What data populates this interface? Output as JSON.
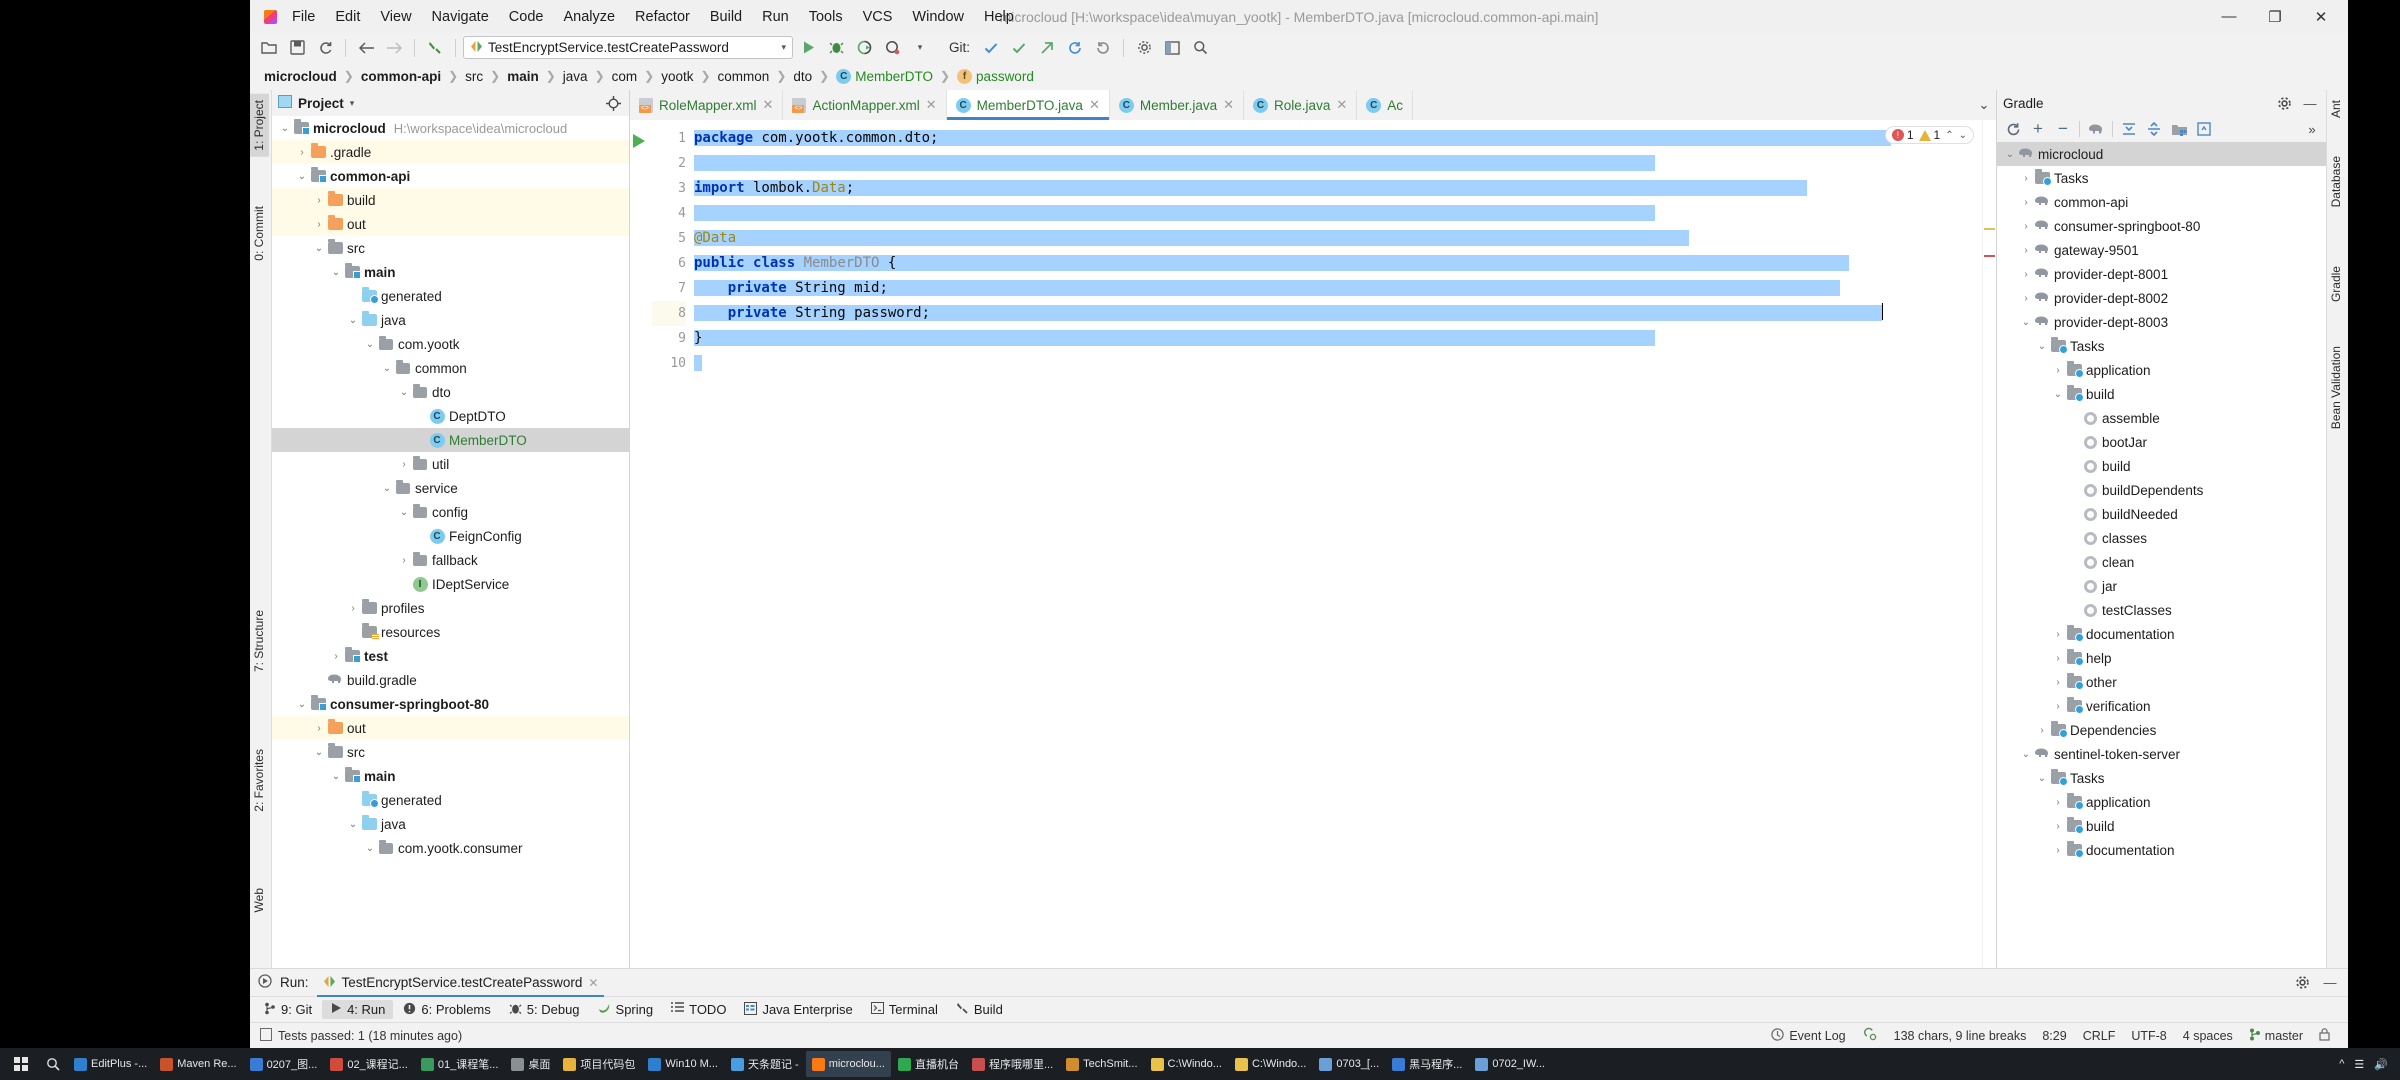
{
  "window": {
    "title": "microcloud [H:\\workspace\\idea\\muyan_yootk] - MemberDTO.java [microcloud.common-api.main]",
    "minimize": "—",
    "maximize": "❐",
    "close": "✕"
  },
  "menubar": [
    "File",
    "Edit",
    "View",
    "Navigate",
    "Code",
    "Analyze",
    "Refactor",
    "Build",
    "Run",
    "Tools",
    "VCS",
    "Window",
    "Help"
  ],
  "toolbar": {
    "open_icon": "folder-open-icon",
    "save_icon": "save-icon",
    "sync_icon": "sync-icon",
    "back_icon": "←",
    "forward_icon": "→",
    "build_icon": "hammer-icon",
    "run_config": "TestEncryptService.testCreatePassword",
    "run_config_caret": "▾",
    "run_icon": "▶",
    "debug_icon": "debug-icon",
    "coverage_icon": "coverage-icon",
    "profile_icon": "profile-icon",
    "profile_caret": "▾",
    "git_label": "Git:",
    "git_update": "✓",
    "git_commit": "✔",
    "git_push": "↗",
    "git_history": "↺",
    "git_rollback": "↶",
    "settings_icon": "gear-icon",
    "layout_icon": "layout-icon",
    "search_icon": "search-icon"
  },
  "breadcrumb": [
    {
      "label": "microcloud",
      "bold": true
    },
    {
      "label": "common-api",
      "bold": true
    },
    {
      "label": "src",
      "bold": false
    },
    {
      "label": "main",
      "bold": true
    },
    {
      "label": "java",
      "bold": false
    },
    {
      "label": "com",
      "bold": false
    },
    {
      "label": "yootk",
      "bold": false
    },
    {
      "label": "common",
      "bold": false
    },
    {
      "label": "dto",
      "bold": false
    },
    {
      "label": "MemberDTO",
      "bold": false,
      "icon": "class-icon",
      "green": true
    },
    {
      "label": "password",
      "bold": false,
      "icon": "field-icon",
      "green": true
    }
  ],
  "left_rail": [
    {
      "label": "1: Project",
      "selected": true
    },
    {
      "label": "0: Commit",
      "selected": false
    },
    {
      "label": "7: Structure",
      "selected": false
    },
    {
      "label": "2: Favorites",
      "selected": false
    },
    {
      "label": "Web",
      "selected": false
    }
  ],
  "right_rail": [
    {
      "label": "Ant"
    },
    {
      "label": "Database"
    },
    {
      "label": "Gradle"
    },
    {
      "label": "Bean Validation"
    }
  ],
  "project_panel": {
    "title": "Project",
    "caret": "▾",
    "locate_icon": "locate-icon",
    "minimize_icon": "—",
    "tree": [
      {
        "indent": 0,
        "tw": "⌄",
        "icon": "module",
        "label": "microcloud",
        "bold": true,
        "sub": "H:\\workspace\\idea\\microcloud"
      },
      {
        "indent": 1,
        "tw": "›",
        "icon": "folder-orange",
        "label": ".gradle",
        "hl": "yellow"
      },
      {
        "indent": 1,
        "tw": "⌄",
        "icon": "module",
        "label": "common-api",
        "bold": true
      },
      {
        "indent": 2,
        "tw": "›",
        "icon": "folder-orange",
        "label": "build",
        "hl": "yellow"
      },
      {
        "indent": 2,
        "tw": "›",
        "icon": "folder-orange",
        "label": "out",
        "hl": "yellow"
      },
      {
        "indent": 2,
        "tw": "⌄",
        "icon": "folder-gray",
        "label": "src"
      },
      {
        "indent": 3,
        "tw": "⌄",
        "icon": "module",
        "label": "main",
        "bold": true
      },
      {
        "indent": 4,
        "tw": "",
        "icon": "folder-generated",
        "label": "generated"
      },
      {
        "indent": 4,
        "tw": "⌄",
        "icon": "folder-blue",
        "label": "java"
      },
      {
        "indent": 5,
        "tw": "⌄",
        "icon": "package",
        "label": "com.yootk"
      },
      {
        "indent": 6,
        "tw": "⌄",
        "icon": "package",
        "label": "common"
      },
      {
        "indent": 7,
        "tw": "⌄",
        "icon": "package",
        "label": "dto"
      },
      {
        "indent": 8,
        "tw": "",
        "icon": "class",
        "label": "DeptDTO"
      },
      {
        "indent": 8,
        "tw": "",
        "icon": "class",
        "label": "MemberDTO",
        "green": true,
        "hl": "sel"
      },
      {
        "indent": 7,
        "tw": "›",
        "icon": "package",
        "label": "util"
      },
      {
        "indent": 6,
        "tw": "⌄",
        "icon": "package",
        "label": "service"
      },
      {
        "indent": 7,
        "tw": "⌄",
        "icon": "package",
        "label": "config"
      },
      {
        "indent": 8,
        "tw": "",
        "icon": "class",
        "label": "FeignConfig"
      },
      {
        "indent": 7,
        "tw": "›",
        "icon": "package",
        "label": "fallback"
      },
      {
        "indent": 7,
        "tw": "",
        "icon": "interface",
        "label": "IDeptService"
      },
      {
        "indent": 4,
        "tw": "›",
        "icon": "folder-gray",
        "label": "profiles"
      },
      {
        "indent": 4,
        "tw": "",
        "icon": "folder-resources",
        "label": "resources"
      },
      {
        "indent": 3,
        "tw": "›",
        "icon": "module",
        "label": "test",
        "bold": true
      },
      {
        "indent": 2,
        "tw": "",
        "icon": "gradle",
        "label": "build.gradle"
      },
      {
        "indent": 1,
        "tw": "⌄",
        "icon": "module",
        "label": "consumer-springboot-80",
        "bold": true
      },
      {
        "indent": 2,
        "tw": "›",
        "icon": "folder-orange",
        "label": "out",
        "hl": "yellow"
      },
      {
        "indent": 2,
        "tw": "⌄",
        "icon": "folder-gray",
        "label": "src"
      },
      {
        "indent": 3,
        "tw": "⌄",
        "icon": "module",
        "label": "main",
        "bold": true
      },
      {
        "indent": 4,
        "tw": "",
        "icon": "folder-generated",
        "label": "generated"
      },
      {
        "indent": 4,
        "tw": "⌄",
        "icon": "folder-blue",
        "label": "java"
      },
      {
        "indent": 5,
        "tw": "⌄",
        "icon": "package",
        "label": "com.yootk.consumer"
      }
    ]
  },
  "editor": {
    "tabs": [
      {
        "label": "RoleMapper.xml",
        "icon": "xml-icon",
        "active": false
      },
      {
        "label": "ActionMapper.xml",
        "icon": "xml-icon",
        "active": false
      },
      {
        "label": "MemberDTO.java",
        "icon": "class-icon",
        "active": true
      },
      {
        "label": "Member.java",
        "icon": "class-icon",
        "active": false
      },
      {
        "label": "Role.java",
        "icon": "class-icon",
        "active": false
      },
      {
        "label": "Ac",
        "icon": "class-icon",
        "active": false
      }
    ],
    "tabs_more": "⌄",
    "line_numbers": [
      "1",
      "2",
      "3",
      "4",
      "5",
      "6",
      "7",
      "8",
      "9",
      "10"
    ],
    "current_line": 8,
    "code_lines": [
      "package com.yootk.common.dto;",
      "",
      "import lombok.Data;",
      "",
      "@Data",
      "public class MemberDTO {",
      "    private String mid;",
      "    private String password;",
      "}",
      ""
    ],
    "inspection": {
      "errors": "1",
      "warnings": "1",
      "up": "⌃",
      "down": "⌄"
    }
  },
  "gradle_panel": {
    "title": "Gradle",
    "settings_icon": "gear-icon",
    "minimize_icon": "—",
    "toolbar": {
      "refresh": "↻",
      "add": "+",
      "remove": "−",
      "execute": "gradle-elephant-icon",
      "expand_all": "expand-all-icon",
      "collapse_all": "collapse-all-icon",
      "module_icon": "module-icon",
      "toggle_icon": "toggle-offline-icon",
      "more": "»"
    },
    "tree": [
      {
        "indent": 0,
        "tw": "⌄",
        "icon": "gradle",
        "label": "microcloud",
        "hl": "sel"
      },
      {
        "indent": 1,
        "tw": "›",
        "icon": "folder-tasks",
        "label": "Tasks"
      },
      {
        "indent": 1,
        "tw": "›",
        "icon": "gradle",
        "label": "common-api"
      },
      {
        "indent": 1,
        "tw": "›",
        "icon": "gradle",
        "label": "consumer-springboot-80"
      },
      {
        "indent": 1,
        "tw": "›",
        "icon": "gradle",
        "label": "gateway-9501"
      },
      {
        "indent": 1,
        "tw": "›",
        "icon": "gradle",
        "label": "provider-dept-8001"
      },
      {
        "indent": 1,
        "tw": "›",
        "icon": "gradle",
        "label": "provider-dept-8002"
      },
      {
        "indent": 1,
        "tw": "⌄",
        "icon": "gradle",
        "label": "provider-dept-8003"
      },
      {
        "indent": 2,
        "tw": "⌄",
        "icon": "folder-tasks",
        "label": "Tasks"
      },
      {
        "indent": 3,
        "tw": "›",
        "icon": "folder-tasks",
        "label": "application"
      },
      {
        "indent": 3,
        "tw": "⌄",
        "icon": "folder-tasks",
        "label": "build"
      },
      {
        "indent": 4,
        "tw": "",
        "icon": "task",
        "label": "assemble"
      },
      {
        "indent": 4,
        "tw": "",
        "icon": "task",
        "label": "bootJar"
      },
      {
        "indent": 4,
        "tw": "",
        "icon": "task",
        "label": "build"
      },
      {
        "indent": 4,
        "tw": "",
        "icon": "task",
        "label": "buildDependents"
      },
      {
        "indent": 4,
        "tw": "",
        "icon": "task",
        "label": "buildNeeded"
      },
      {
        "indent": 4,
        "tw": "",
        "icon": "task",
        "label": "classes"
      },
      {
        "indent": 4,
        "tw": "",
        "icon": "task",
        "label": "clean"
      },
      {
        "indent": 4,
        "tw": "",
        "icon": "task",
        "label": "jar"
      },
      {
        "indent": 4,
        "tw": "",
        "icon": "task",
        "label": "testClasses"
      },
      {
        "indent": 3,
        "tw": "›",
        "icon": "folder-tasks",
        "label": "documentation"
      },
      {
        "indent": 3,
        "tw": "›",
        "icon": "folder-tasks",
        "label": "help"
      },
      {
        "indent": 3,
        "tw": "›",
        "icon": "folder-tasks",
        "label": "other"
      },
      {
        "indent": 3,
        "tw": "›",
        "icon": "folder-tasks",
        "label": "verification"
      },
      {
        "indent": 2,
        "tw": "›",
        "icon": "folder-tasks",
        "label": "Dependencies"
      },
      {
        "indent": 1,
        "tw": "⌄",
        "icon": "gradle",
        "label": "sentinel-token-server"
      },
      {
        "indent": 2,
        "tw": "⌄",
        "icon": "folder-tasks",
        "label": "Tasks"
      },
      {
        "indent": 3,
        "tw": "›",
        "icon": "folder-tasks",
        "label": "application"
      },
      {
        "indent": 3,
        "tw": "›",
        "icon": "folder-tasks",
        "label": "build"
      },
      {
        "indent": 3,
        "tw": "›",
        "icon": "folder-tasks",
        "label": "documentation"
      }
    ]
  },
  "run_window": {
    "icon": "run-icon",
    "label": "Run:",
    "tab_label": "TestEncryptService.testCreatePassword",
    "tab_close": "✕",
    "settings_icon": "gear-icon",
    "minimize_icon": "—"
  },
  "tool_buttons": [
    {
      "label": "9: Git",
      "icon": "git-icon",
      "selected": false
    },
    {
      "label": "4: Run",
      "icon": "run-icon",
      "selected": true
    },
    {
      "label": "6: Problems",
      "icon": "problems-icon",
      "selected": false
    },
    {
      "label": "5: Debug",
      "icon": "debug-icon",
      "selected": false
    },
    {
      "label": "Spring",
      "icon": "spring-icon",
      "selected": false
    },
    {
      "label": "TODO",
      "icon": "todo-icon",
      "selected": false
    },
    {
      "label": "Java Enterprise",
      "icon": "java-enterprise-icon",
      "selected": false
    },
    {
      "label": "Terminal",
      "icon": "terminal-icon",
      "selected": false
    },
    {
      "label": "Build",
      "icon": "build-icon",
      "selected": false
    }
  ],
  "status_bar": {
    "message": "Tests passed: 1 (18 minutes ago)",
    "message_icon": "notification-icon",
    "event_log": "Event Log",
    "event_log_icon": "event-log-icon",
    "metrics_icon": "memory-icon",
    "chars": "138 chars, 9 line breaks",
    "caret_pos": "8:29",
    "line_sep": "CRLF",
    "encoding": "UTF-8",
    "indent": "4 spaces",
    "branch": "master",
    "branch_icon": "branch-icon",
    "lock_icon": "lock-icon"
  },
  "taskbar": {
    "start_icon": "windows-start-icon",
    "search_icon": "search-icon",
    "apps": [
      {
        "label": "EditPlus -...",
        "color": "#2f7fd1"
      },
      {
        "label": "Maven Re...",
        "color": "#c9522b"
      },
      {
        "label": "0207_图...",
        "color": "#3a7bd5"
      },
      {
        "label": "02_课程记...",
        "color": "#d14b3a"
      },
      {
        "label": "01_课程笔...",
        "color": "#3a9a5c"
      },
      {
        "label": "桌面",
        "color": "#8a8f94"
      },
      {
        "label": "项目代码包",
        "color": "#e8b33b"
      },
      {
        "label": "Win10 M...",
        "color": "#2f7fd1"
      },
      {
        "label": "天条题记 -",
        "color": "#4a9de0"
      },
      {
        "label": "microclou...",
        "color": "#f97a12",
        "active": true
      },
      {
        "label": "直播机台",
        "color": "#2fa84f"
      },
      {
        "label": "程序哦哪里...",
        "color": "#c94f4f"
      },
      {
        "label": "TechSmit...",
        "color": "#d18c2f"
      },
      {
        "label": "C:\\Windo...",
        "color": "#e8c24a"
      },
      {
        "label": "C:\\Windo...",
        "color": "#e8c24a"
      },
      {
        "label": "0703_[...",
        "color": "#6a9fd8"
      },
      {
        "label": "黑马程序...",
        "color": "#3a7bd5"
      },
      {
        "label": "0702_IW...",
        "color": "#6a9fd8"
      }
    ]
  }
}
